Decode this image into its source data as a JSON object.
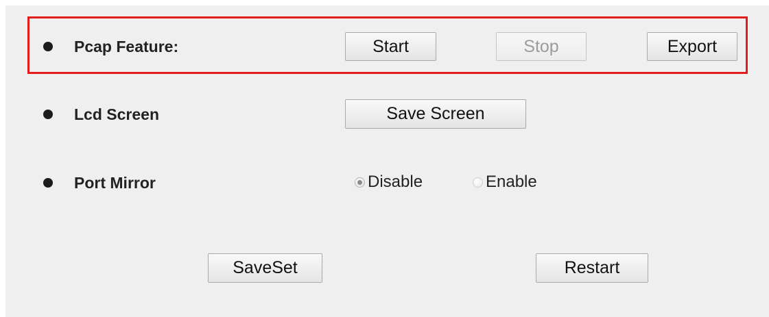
{
  "pcap": {
    "label": "Pcap Feature:",
    "start_label": "Start",
    "stop_label": "Stop",
    "export_label": "Export"
  },
  "lcd": {
    "label": "Lcd Screen",
    "save_screen_label": "Save Screen"
  },
  "port_mirror": {
    "label": "Port Mirror",
    "options": [
      {
        "label": "Disable",
        "selected": true
      },
      {
        "label": "Enable",
        "selected": false
      }
    ]
  },
  "footer": {
    "saveset_label": "SaveSet",
    "restart_label": "Restart"
  },
  "colors": {
    "highlight": "#e31b1b",
    "panel_background": "#efefef"
  }
}
